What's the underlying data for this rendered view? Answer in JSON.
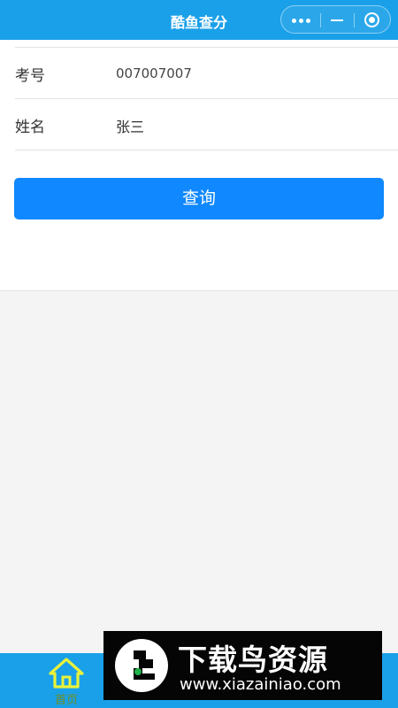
{
  "header": {
    "title": "酷鱼查分",
    "capsule": {
      "more_icon": "more-dots-icon",
      "minimize_icon": "minimize-icon",
      "close_icon": "target-circle-icon"
    }
  },
  "form": {
    "rows": [
      {
        "label": "考号",
        "value": "007007007"
      },
      {
        "label": "姓名",
        "value": "张三"
      }
    ],
    "submit_label": "查询"
  },
  "tabbar": {
    "tabs": [
      {
        "label": "首页",
        "icon": "home-icon",
        "active": true
      },
      {
        "label": "",
        "icon": "",
        "active": false
      },
      {
        "label": "",
        "icon": "",
        "active": false
      }
    ]
  },
  "watermark": {
    "title": "下载鸟资源",
    "url": "www.xiazainiao.com",
    "logo": "xiazainiao-logo"
  },
  "colors": {
    "header_bg": "#1aa0e8",
    "button_bg": "#1088ff",
    "tabbar_bg": "#1aa0e8",
    "active_tab_icon": "#e9f23a",
    "page_bg": "#f4f4f4"
  }
}
